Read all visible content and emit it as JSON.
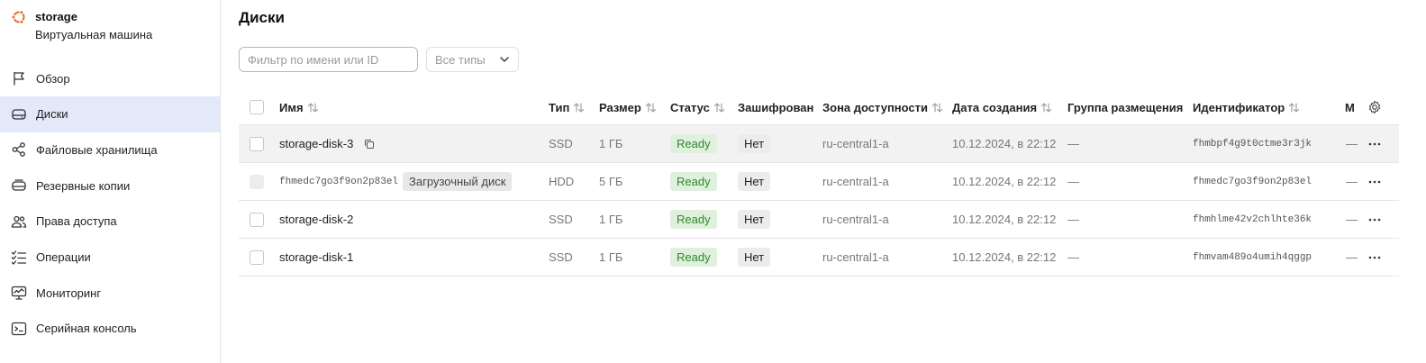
{
  "vm": {
    "name": "storage",
    "type": "Виртуальная машина",
    "brand_color": "#e8702a"
  },
  "nav": {
    "items": [
      {
        "icon": "flag-icon",
        "label": "Обзор",
        "active": false
      },
      {
        "icon": "disk-icon",
        "label": "Диски",
        "active": true
      },
      {
        "icon": "share-nodes-icon",
        "label": "Файловые хранилища",
        "active": false
      },
      {
        "icon": "backup-disk-icon",
        "label": "Резервные копии",
        "active": false
      },
      {
        "icon": "persons-icon",
        "label": "Права доступа",
        "active": false
      },
      {
        "icon": "list-check-icon",
        "label": "Операции",
        "active": false
      },
      {
        "icon": "monitor-chart-icon",
        "label": "Мониторинг",
        "active": false
      },
      {
        "icon": "terminal-icon",
        "label": "Серийная консоль",
        "active": false
      }
    ]
  },
  "page": {
    "title": "Диски",
    "filter_placeholder": "Фильтр по имени или ID",
    "type_select_value": "Все типы"
  },
  "table": {
    "headers": {
      "name": "Имя",
      "type": "Тип",
      "size": "Размер",
      "status": "Статус",
      "encrypted": "Зашифрован",
      "zone": "Зона доступности",
      "created": "Дата создания",
      "placement": "Группа размещения",
      "id": "Идентификатор",
      "m": "М"
    },
    "rows": [
      {
        "name": "storage-disk-3",
        "name_is_id": false,
        "boot_label": "",
        "type": "SSD",
        "size": "1 ГБ",
        "status": "Ready",
        "encrypted": "Нет",
        "zone": "ru-central1-a",
        "created": "10.12.2024, в 22:12",
        "placement": "—",
        "id": "fhmbpf4g9t0ctme3r3jk",
        "m": "—"
      },
      {
        "name": "fhmedc7go3f9on2p83el",
        "name_is_id": true,
        "boot_label": "Загрузочный диск",
        "type": "HDD",
        "size": "5 ГБ",
        "status": "Ready",
        "encrypted": "Нет",
        "zone": "ru-central1-a",
        "created": "10.12.2024, в 22:12",
        "placement": "—",
        "id": "fhmedc7go3f9on2p83el",
        "m": "—"
      },
      {
        "name": "storage-disk-2",
        "name_is_id": false,
        "boot_label": "",
        "type": "SSD",
        "size": "1 ГБ",
        "status": "Ready",
        "encrypted": "Нет",
        "zone": "ru-central1-a",
        "created": "10.12.2024, в 22:12",
        "placement": "—",
        "id": "fhmhlme42v2chlhte36k",
        "m": "—"
      },
      {
        "name": "storage-disk-1",
        "name_is_id": false,
        "boot_label": "",
        "type": "SSD",
        "size": "1 ГБ",
        "status": "Ready",
        "encrypted": "Нет",
        "zone": "ru-central1-a",
        "created": "10.12.2024, в 22:12",
        "placement": "—",
        "id": "fhmvam489o4umih4qggp",
        "m": "—"
      }
    ]
  }
}
